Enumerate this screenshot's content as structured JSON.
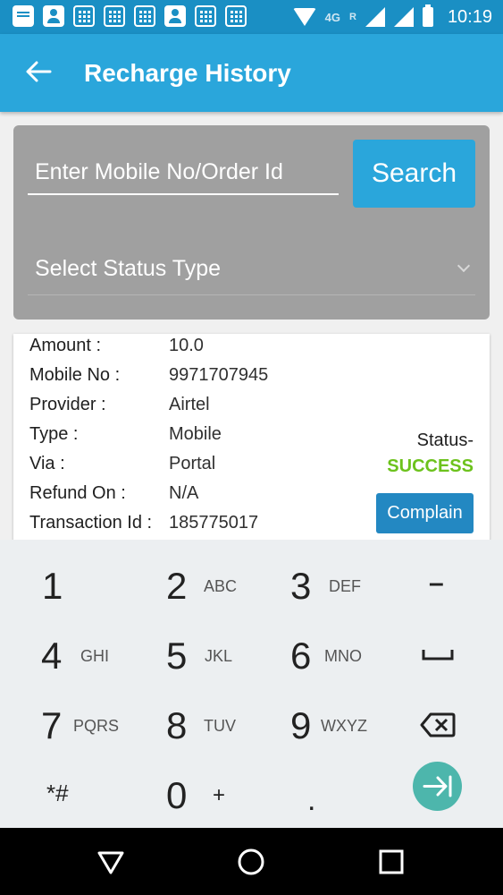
{
  "status_bar": {
    "network": "4G",
    "roaming": "R",
    "time": "10:19"
  },
  "app_bar": {
    "title": "Recharge History"
  },
  "search": {
    "placeholder": "Enter Mobile No/Order Id",
    "button_label": "Search",
    "status_select_label": "Select Status Type"
  },
  "transaction": {
    "fields": [
      {
        "label": "Amount :",
        "value": "10.0"
      },
      {
        "label": "Mobile No :",
        "value": "9971707945"
      },
      {
        "label": "Provider :",
        "value": "Airtel"
      },
      {
        "label": "Type :",
        "value": "Mobile"
      },
      {
        "label": "Via :",
        "value": "Portal"
      },
      {
        "label": "Refund On :",
        "value": "N/A"
      },
      {
        "label": "Transaction Id :",
        "value": "185775017"
      }
    ],
    "status_label": "Status-",
    "status_value": "SUCCESS",
    "status_color": "#6cc21c",
    "complain_label": "Complain"
  },
  "keyboard": {
    "keys": [
      {
        "digit": "1",
        "letters": ""
      },
      {
        "digit": "2",
        "letters": "ABC"
      },
      {
        "digit": "3",
        "letters": "DEF"
      },
      {
        "digit": "4",
        "letters": "GHI"
      },
      {
        "digit": "5",
        "letters": "JKL"
      },
      {
        "digit": "6",
        "letters": "MNO"
      },
      {
        "digit": "7",
        "letters": "PQRS"
      },
      {
        "digit": "8",
        "letters": "TUV"
      },
      {
        "digit": "9",
        "letters": "WXYZ"
      },
      {
        "digit": "*#",
        "letters": ""
      },
      {
        "digit": "0",
        "letters": "+"
      },
      {
        "digit": ".",
        "letters": ""
      }
    ],
    "minus": "–"
  },
  "colors": {
    "status_bar": "#1a8fc4",
    "app_bar": "#2aa6db",
    "accent": "#2aa6db",
    "go_key": "#4db6ac"
  }
}
